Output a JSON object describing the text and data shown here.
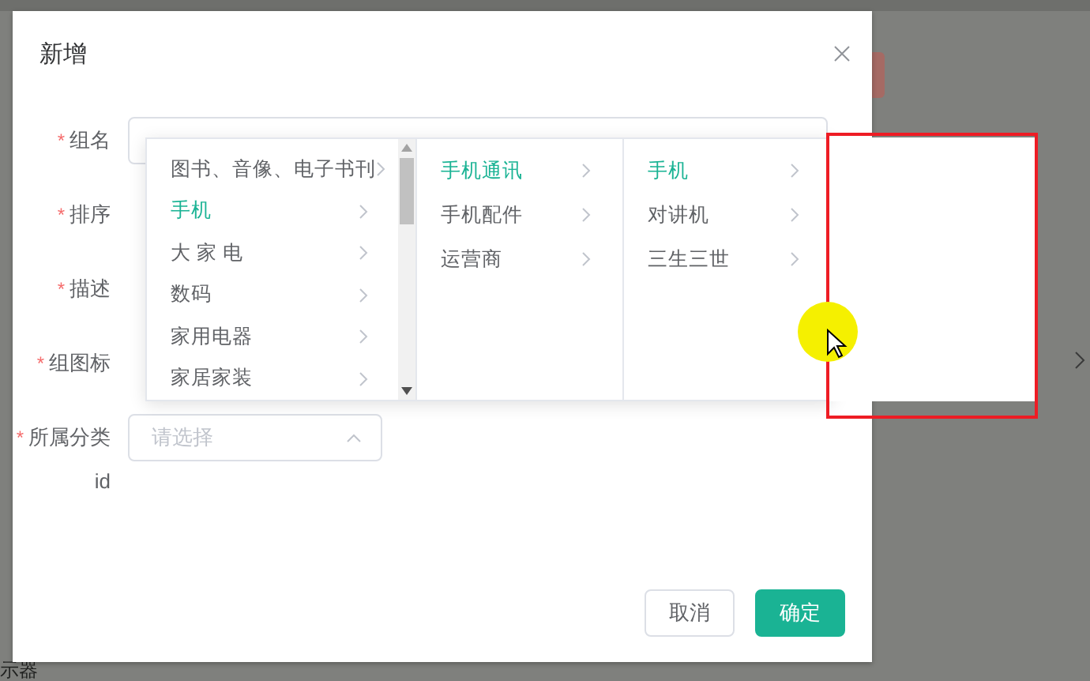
{
  "background": {
    "left_fragments": [
      "示器"
    ]
  },
  "dialog": {
    "title": "新增",
    "fields": [
      {
        "label": "组名",
        "required_mark": "*",
        "kind": "input"
      },
      {
        "label": "排序",
        "required_mark": "*",
        "kind": "covered"
      },
      {
        "label": "描述",
        "required_mark": "*",
        "kind": "covered"
      },
      {
        "label": "组图标",
        "required_mark": "*",
        "kind": "covered"
      },
      {
        "label": "所属分类",
        "required_mark": "*",
        "kind": "select",
        "placeholder": "请选择",
        "expanded": true
      },
      {
        "label": "id",
        "kind": "text"
      }
    ],
    "buttons": [
      {
        "label": "取消",
        "kind": "default"
      },
      {
        "label": "确定",
        "kind": "primary"
      }
    ]
  },
  "cascader": {
    "columns": [
      {
        "items": [
          {
            "label": "图书、音像、电子书刊",
            "selected": false
          },
          {
            "label": "手机",
            "selected": true
          },
          {
            "label": "大 家 电",
            "selected": false
          },
          {
            "label": "数码",
            "selected": false
          },
          {
            "label": "家用电器",
            "selected": false
          },
          {
            "label": "家居家装",
            "selected": false
          }
        ]
      },
      {
        "items": [
          {
            "label": "手机通讯",
            "selected": true
          },
          {
            "label": "手机配件",
            "selected": false
          },
          {
            "label": "运营商",
            "selected": false
          }
        ]
      },
      {
        "items": [
          {
            "label": "手机",
            "selected": true
          },
          {
            "label": "对讲机",
            "selected": false
          },
          {
            "label": "三生三世",
            "selected": false
          }
        ]
      }
    ]
  }
}
